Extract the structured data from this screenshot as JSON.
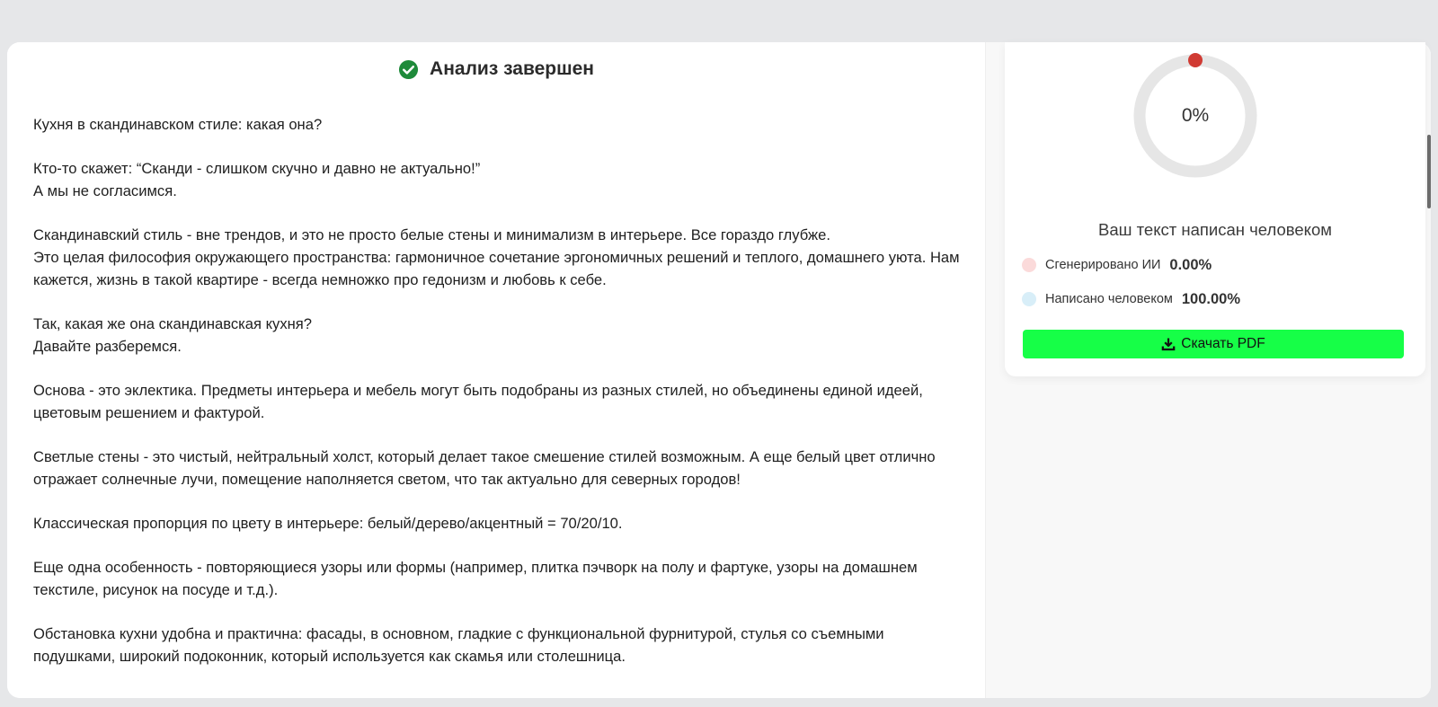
{
  "header": {
    "title": "Анализ завершен",
    "icon": "check-circle-icon",
    "icon_color": "#1e8a3a"
  },
  "text": {
    "paragraphs": [
      "Кухня в скандинавском стиле: какая она?",
      "Кто-то скажет: “Сканди - слишком скучно и давно не актуально!”\nА мы не согласимся.",
      "Скандинавский стиль - вне трендов, и это не просто белые стены и минимализм в интерьере. Все гораздо глубже.\nЭто целая философия окружающего пространства: гармоничное сочетание эргономичных решений и теплого, домашнего уюта. Нам кажется, жизнь в такой квартире - всегда немножко про гедонизм и любовь к себе.",
      "Так, какая же она скандинавская кухня?\nДавайте разберемся.",
      "Основа - это эклектика. Предметы интерьера и мебель могут быть подобраны из разных стилей, но объединены единой идеей, цветовым решением и фактурой.",
      "Светлые стены - это чистый, нейтральный холст, который делает такое смешение стилей возможным. А еще белый цвет отлично отражает солнечные лучи, помещение наполняется светом, что так актуально для северных городов!",
      "Классическая пропорция по цвету в интерьере: белый/дерево/акцентный = 70/20/10.",
      "Еще одна особенность - повторяющиеся узоры или формы (например, плитка пэчворк на полу и фартуке, узоры на домашнем текстиле, рисунок на посуде и т.д.).",
      "Обстановка кухни удобна и практична: фасады, в основном, гладкие с функциональной фурнитурой, стулья со съемными подушками, широкий подоконник, который используется как скамья или столешница."
    ]
  },
  "result": {
    "gauge_percent_label": "0%",
    "gauge_value": 0,
    "gauge_track_color": "#e6e6e6",
    "gauge_marker_color": "#d03b33",
    "verdict": "Ваш текст написан человеком",
    "ai": {
      "label": "Сгенерировано ИИ",
      "value": "0.00%",
      "color": "#fbdada"
    },
    "human": {
      "label": "Написано человеком",
      "value": "100.00%",
      "color": "#d8eef8"
    },
    "download_label": "Скачать PDF",
    "download_icon": "download-icon",
    "button_color": "#16ff47"
  }
}
